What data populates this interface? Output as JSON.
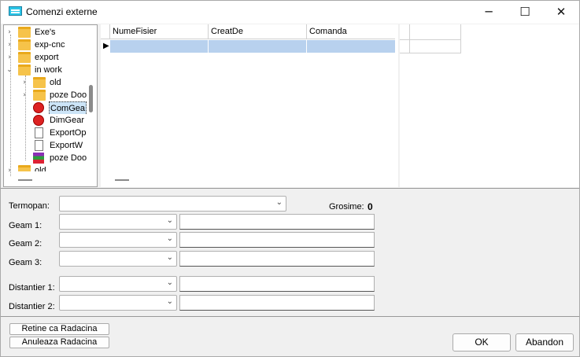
{
  "window": {
    "title": "Comenzi externe",
    "icon": "app-icon",
    "controls": {
      "minimize": "─",
      "maximize": "☐",
      "close": "✕"
    }
  },
  "tree": {
    "items": [
      {
        "label": "Exe's",
        "expander": "›",
        "icon": "folder-icon"
      },
      {
        "label": "exp-cnc",
        "expander": "›",
        "icon": "folder-icon"
      },
      {
        "label": "export",
        "expander": "›",
        "icon": "folder-icon"
      },
      {
        "label": "in work",
        "expander": "⌄",
        "icon": "folder-icon"
      },
      {
        "label": "old",
        "expander": "›",
        "icon": "folder-icon"
      },
      {
        "label": "poze Doo",
        "expander": "›",
        "icon": "folder-icon"
      },
      {
        "label": "ComGea",
        "expander": "",
        "icon": "stop-file-icon",
        "selected": true
      },
      {
        "label": "DimGear",
        "expander": "",
        "icon": "stop-file-icon"
      },
      {
        "label": "ExportOp",
        "expander": "",
        "icon": "file-icon"
      },
      {
        "label": "ExportW",
        "expander": "",
        "icon": "file-icon"
      },
      {
        "label": "poze Doo",
        "expander": "",
        "icon": "rar-archive-icon"
      },
      {
        "label": "old",
        "expander": "›",
        "icon": "folder-icon"
      }
    ]
  },
  "grid": {
    "columns": [
      "NumeFisier",
      "CreatDe",
      "Comanda"
    ],
    "row_indicator": "▶",
    "rows": [
      [
        "",
        "",
        ""
      ]
    ]
  },
  "form": {
    "termopan_label": "Termopan:",
    "grosime_label": "Grosime:",
    "grosime_value": "0",
    "geam1_label": "Geam 1:",
    "geam2_label": "Geam 2:",
    "geam3_label": "Geam 3:",
    "distantier1_label": "Distantier 1:",
    "distantier2_label": "Distantier 2:",
    "combo_arrow": "⌄"
  },
  "buttons": {
    "retine": "Retine ca Radacina",
    "anuleaza": "Anuleaza Radacina",
    "ok": "OK",
    "abandon": "Abandon"
  },
  "colors": {
    "selection": "#b8d1ee",
    "title_icon": "#2bc6e8"
  }
}
